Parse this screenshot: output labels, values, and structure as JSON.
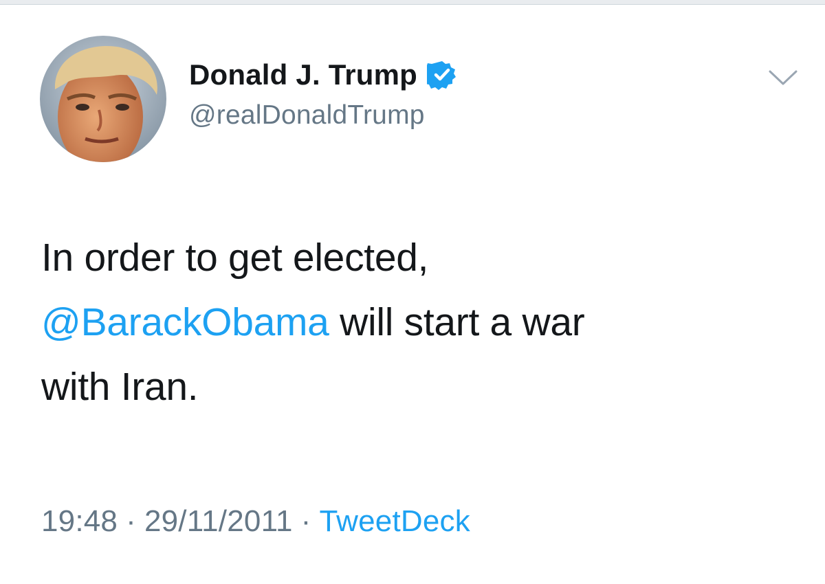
{
  "tweet": {
    "author": {
      "display_name": "Donald J. Trump",
      "handle": "@realDonaldTrump",
      "verified": true
    },
    "text": {
      "line1": "In order to get elected,",
      "mention": "@BarackObama",
      "line2_rest": " will start a war",
      "line3": "with Iran."
    },
    "meta": {
      "time": "19:48",
      "separator": "·",
      "date": "29/11/2011",
      "source": "TweetDeck"
    }
  },
  "icons": {
    "verified": "verified-badge-icon",
    "menu": "chevron-down-icon"
  },
  "colors": {
    "accent": "#1da1f2",
    "text": "#14171a",
    "secondary": "#657786",
    "background": "#ffffff"
  }
}
